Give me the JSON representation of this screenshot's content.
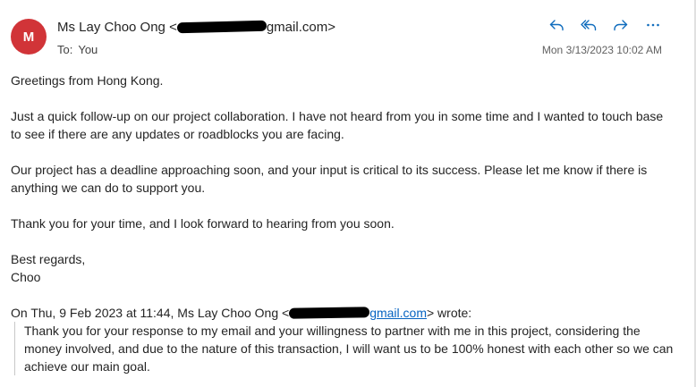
{
  "sender": {
    "avatar_letter": "M",
    "avatar_color": "#d13438",
    "name": "Ms Lay Choo Ong",
    "email_open": "<",
    "email_domain": "gmail.com>"
  },
  "recipients": {
    "to_label": "To:",
    "to_value": "You"
  },
  "timestamp": "Mon 3/13/2023 10:02 AM",
  "toolbar": {
    "icons": [
      "reply-icon",
      "reply-all-icon",
      "forward-icon",
      "more-icon"
    ],
    "accent_color": "#0f6cbd"
  },
  "body": {
    "greeting": "Greetings from Hong Kong.",
    "para1": "Just a quick follow-up on our project collaboration. I have not heard from you in some time and I wanted to touch base to see if there are any updates or roadblocks you are facing.",
    "para2": "Our project has a deadline approaching soon, and your input is critical to its success. Please let me know if there is anything we can do to support you.",
    "para3": "Thank you for your time, and I look forward to hearing from you soon.",
    "signoff_line1": "Best regards,",
    "signoff_line2": "Choo"
  },
  "quoted": {
    "header_prefix": "On Thu, 9 Feb 2023 at 11:44, Ms Lay Choo Ong <",
    "header_link_domain": "gmail.com",
    "header_suffix": "> wrote:",
    "text": "Thank you for your response to my email and your willingness to partner with me in this project, considering the money involved, and due to the nature of this transaction, I will want us to be 100% honest with each other so we can achieve our main goal."
  }
}
